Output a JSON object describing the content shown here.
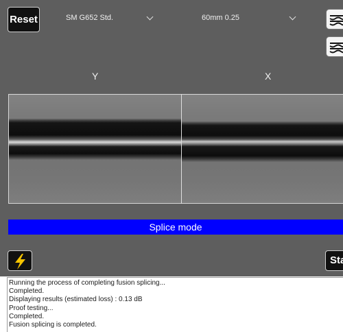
{
  "toolbar": {
    "reset_label": "Reset",
    "fiber_type": "SM G652 Std.",
    "cleave_setting": "60mm 0.25",
    "start_label": "Start"
  },
  "views": {
    "y_label": "Y",
    "x_label": "X"
  },
  "mode": {
    "label": "Splice mode"
  },
  "log": {
    "lines": [
      "Running the process of completing fusion splicing...",
      "Completed.",
      "Displaying results (estimated loss) : 0.13 dB",
      "Proof testing...",
      "Completed.",
      "Fusion splicing is completed."
    ]
  },
  "icons": {
    "view_toggle_1": "fiber-view-icon",
    "view_toggle_2": "fiber-view-icon",
    "arc": "lightning-icon"
  },
  "colors": {
    "panel_bg": "#5e5e5e",
    "mode_bar": "#0000ff",
    "arc_icon": "#f5c400",
    "button_bg": "#111111"
  }
}
